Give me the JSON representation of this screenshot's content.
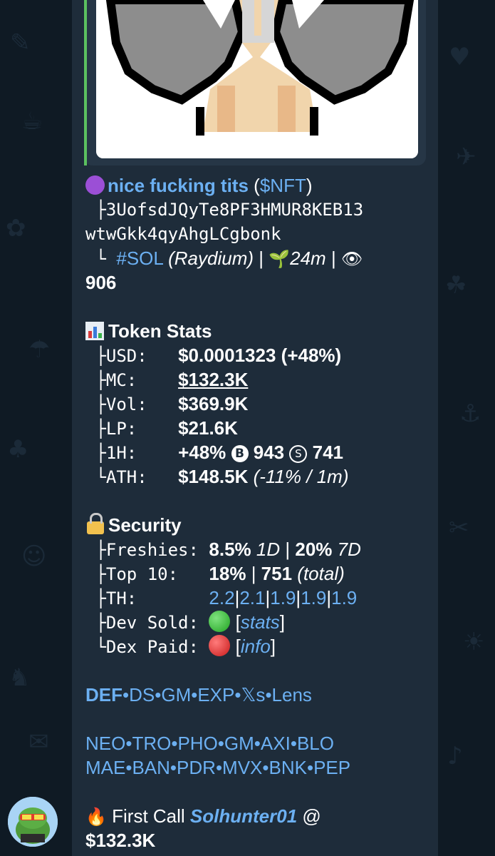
{
  "token": {
    "name": "nice fucking tits",
    "ticker": "$NFT",
    "address_line1": "3UofsdJQyTe8PF3HMUR8KEB13",
    "address_line2": "wtwGkk4qyAhgLCgbonk",
    "chain": "#SOL",
    "dex": "(Raydium)",
    "age": "24m",
    "views": "906"
  },
  "stats": {
    "header": "Token Stats",
    "usd_label": "USD:",
    "usd_value": "$0.0001323",
    "usd_change": "(+48%)",
    "mc_label": "MC:",
    "mc_value": "$132.3K",
    "vol_label": "Vol:",
    "vol_value": "$369.9K",
    "lp_label": "LP:",
    "lp_value": "$21.6K",
    "h1_label": "1H:",
    "h1_change": "+48%",
    "h1_buys_icon": "B",
    "h1_buys": "943",
    "h1_sells_icon": "S",
    "h1_sells": "741",
    "ath_label": "ATH:",
    "ath_value": "$148.5K",
    "ath_detail": "(-11% / 1m)"
  },
  "security": {
    "header": "Security",
    "freshies_label": "Freshies:",
    "freshies_1d": "8.5%",
    "freshies_1d_unit": "1D",
    "freshies_7d": "20%",
    "freshies_7d_unit": "7D",
    "top10_label": "Top 10:",
    "top10_pct": "18%",
    "top10_total": "751",
    "top10_total_unit": "(total)",
    "th_label": "TH:",
    "th_values": [
      "2.2",
      "2.1",
      "1.9",
      "1.9",
      "1.9"
    ],
    "dev_sold_label": "Dev Sold:",
    "dev_sold_link": "stats",
    "dex_paid_label": "Dex Paid:",
    "dex_paid_link": "info"
  },
  "links_row1": [
    "DEF",
    "DS",
    "GM",
    "EXP",
    "𝕏s",
    "Lens"
  ],
  "links_row2": [
    "NEO",
    "TRO",
    "PHO",
    "GM",
    "AXI",
    "BLO"
  ],
  "links_row3": [
    "MAE",
    "BAN",
    "PDR",
    "MVX",
    "BNK",
    "PEP"
  ],
  "first_call": {
    "label": "First Call",
    "user": "Solhunter01",
    "at": "@",
    "value": "$132.3K"
  },
  "colors": {
    "link": "#6cb0f2",
    "bubble": "#1e2c3a",
    "accent_bar": "#5bc15f"
  }
}
